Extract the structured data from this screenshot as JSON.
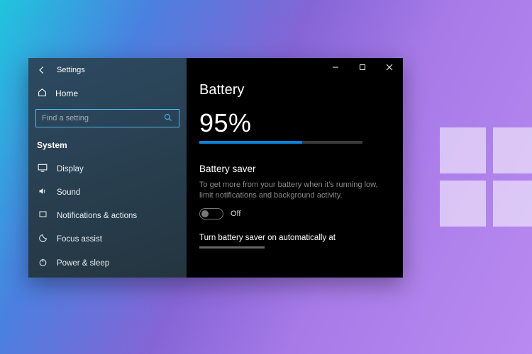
{
  "app": {
    "title": "Settings"
  },
  "sidebar": {
    "home_label": "Home",
    "search_placeholder": "Find a setting",
    "category": "System",
    "items": [
      {
        "label": "Display"
      },
      {
        "label": "Sound"
      },
      {
        "label": "Notifications & actions"
      },
      {
        "label": "Focus assist"
      },
      {
        "label": "Power & sleep"
      }
    ]
  },
  "page": {
    "title": "Battery",
    "percent_text": "95%",
    "percent_value": 95,
    "saver": {
      "heading": "Battery saver",
      "description": "To get more from your battery when it's running low, limit notifications and background activity.",
      "toggle_state": "Off",
      "auto_label": "Turn battery saver on automatically at"
    }
  },
  "colors": {
    "accent": "#0a84d8"
  }
}
